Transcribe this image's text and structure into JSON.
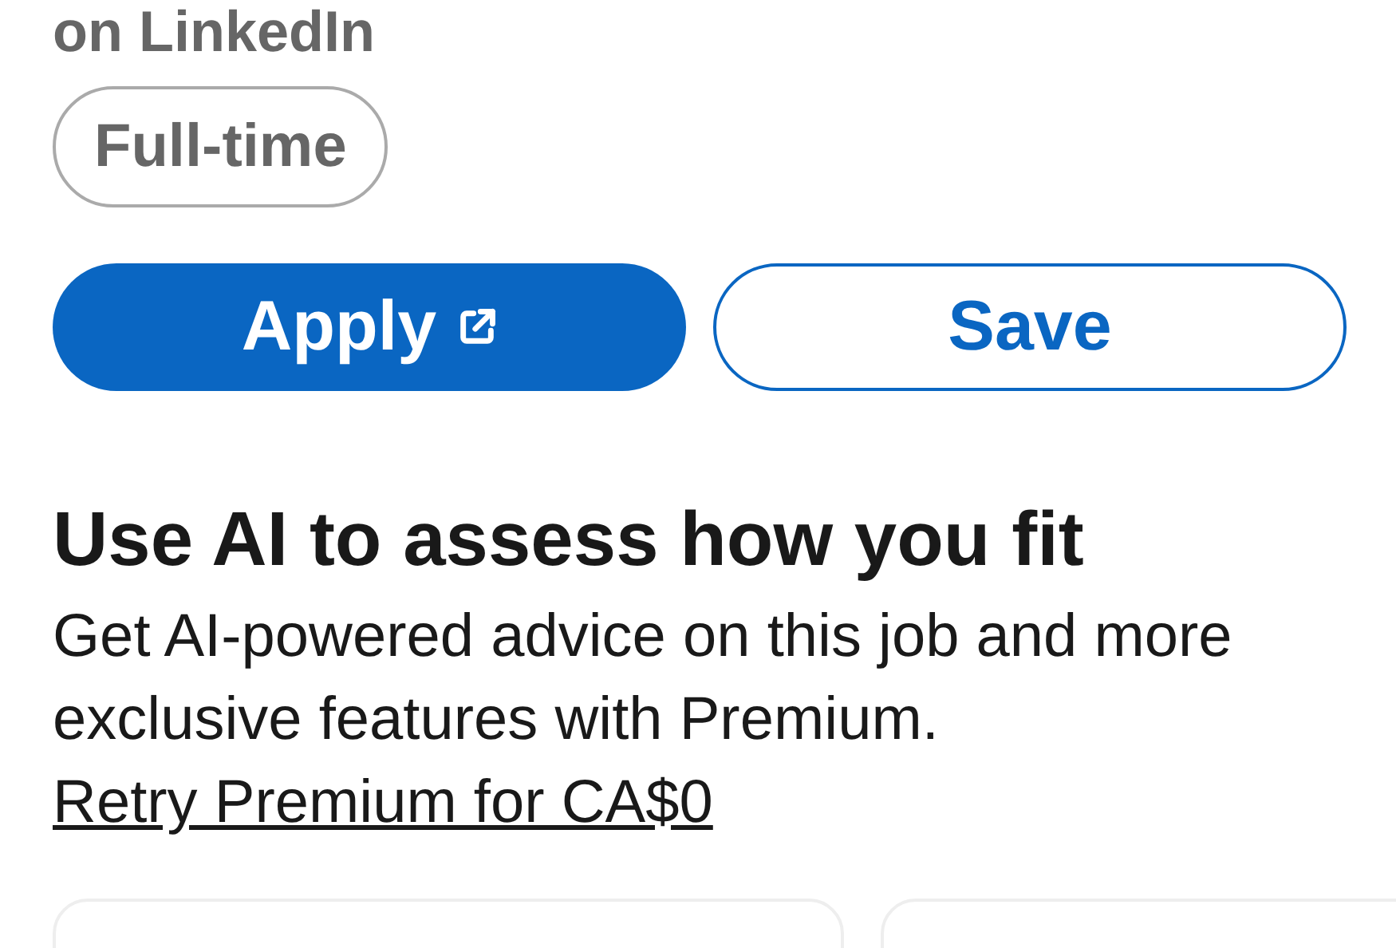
{
  "source_line": "on LinkedIn",
  "tags": [
    {
      "label": "Full-time"
    }
  ],
  "actions": [
    {
      "label": "Apply",
      "kind": "primary",
      "external": true
    },
    {
      "label": "Save",
      "kind": "secondary",
      "external": false
    }
  ],
  "premium": {
    "title": "Use AI to assess how you fit",
    "text": "Get AI-powered advice on this job and more exclusive features with Premium.",
    "link": "Retry Premium for CA$0"
  },
  "cards": [
    {
      "kind": "card"
    },
    {
      "kind": "card"
    }
  ]
}
